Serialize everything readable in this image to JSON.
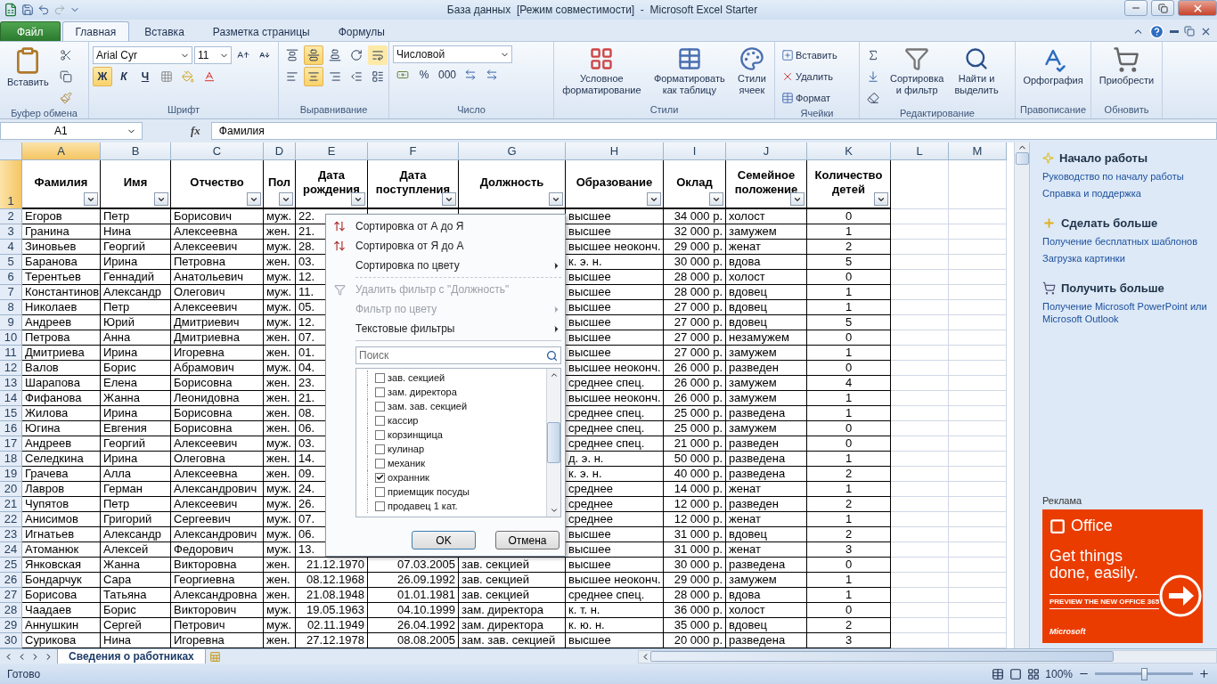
{
  "window": {
    "title": "База данных  [Режим совместимости]  -  Microsoft Excel Starter"
  },
  "tabs": [
    {
      "label": "Файл",
      "kind": "file",
      "selected": false
    },
    {
      "label": "Главная",
      "kind": "tab",
      "selected": true
    },
    {
      "label": "Вставка",
      "kind": "tab",
      "selected": false
    },
    {
      "label": "Разметка страницы",
      "kind": "tab",
      "selected": false
    },
    {
      "label": "Формулы",
      "kind": "tab",
      "selected": false
    }
  ],
  "ribbon": {
    "clipboard": {
      "label": "Буфер обмена",
      "paste": "Вставить"
    },
    "font": {
      "label": "Шрифт",
      "font_name": "Arial Cyr",
      "font_size": "11",
      "bold": {
        "label": "Ж",
        "on": true
      },
      "italic": "К",
      "underline": "Ч"
    },
    "alignment": {
      "label": "Выравнивание",
      "middle_on": true,
      "center_on": true
    },
    "number": {
      "label": "Число",
      "format": "Числовой",
      "percent": "%",
      "thousands": "000"
    },
    "styles": {
      "label": "Стили",
      "buttons": [
        "Условное\nформатирование",
        "Форматировать\nкак таблицу",
        "Стили\nячеек"
      ]
    },
    "cells": {
      "label": "Ячейки",
      "buttons": [
        "Вставить",
        "Удалить",
        "Формат"
      ]
    },
    "editing": {
      "label": "Редактирование",
      "buttons": [
        "Сортировка\nи фильтр",
        "Найти и\nвыделить"
      ]
    },
    "spelling": {
      "label": "Правописание",
      "button": "Орфография"
    },
    "update": {
      "label": "Обновить",
      "button": "Приобрести"
    }
  },
  "formula_bar": {
    "name_box": "A1",
    "fx": "fx",
    "value": "Фамилия"
  },
  "table": {
    "column_letters": [
      {
        "label": "A",
        "selected": true
      },
      {
        "label": "B",
        "selected": false
      },
      {
        "label": "C",
        "selected": false
      },
      {
        "label": "D",
        "selected": false
      },
      {
        "label": "E",
        "selected": false
      },
      {
        "label": "F",
        "selected": false
      },
      {
        "label": "G",
        "selected": false
      },
      {
        "label": "H",
        "selected": false
      },
      {
        "label": "I",
        "selected": false
      },
      {
        "label": "J",
        "selected": false
      },
      {
        "label": "K",
        "selected": false
      },
      {
        "label": "L",
        "selected": false
      },
      {
        "label": "M",
        "selected": false
      }
    ],
    "header_row": {
      "number": "1",
      "selected": true
    },
    "columns": [
      "Фамилия",
      "Имя",
      "Отчество",
      "Пол",
      "Дата\nрождения",
      "Дата\nпоступления",
      "Должность",
      "Образование",
      "Оклад",
      "Семейное\nположение",
      "Количество\nдетей"
    ],
    "rows": [
      {
        "n": "2",
        "cells": [
          "Егоров",
          "Петр",
          "Борисович",
          "муж.",
          "22.",
          null,
          null,
          "высшее",
          "34 000 р.",
          "холост",
          "0"
        ]
      },
      {
        "n": "3",
        "cells": [
          "Гранина",
          "Нина",
          "Алексеевна",
          "жен.",
          "21.",
          null,
          null,
          "высшее",
          "32 000 р.",
          "замужем",
          "1"
        ]
      },
      {
        "n": "4",
        "cells": [
          "Зиновьев",
          "Георгий",
          "Алексеевич",
          "муж.",
          "28.",
          null,
          null,
          "высшее неоконч.",
          "29 000 р.",
          "женат",
          "2"
        ]
      },
      {
        "n": "5",
        "cells": [
          "Баранова",
          "Ирина",
          "Петровна",
          "жен.",
          "03.",
          null,
          null,
          "к. э. н.",
          "30 000 р.",
          "вдова",
          "5"
        ]
      },
      {
        "n": "6",
        "cells": [
          "Терентьев",
          "Геннадий",
          "Анатольевич",
          "муж.",
          "12.",
          null,
          null,
          "высшее",
          "28 000 р.",
          "холост",
          "0"
        ]
      },
      {
        "n": "7",
        "cells": [
          "Константинов",
          "Александр",
          "Олегович",
          "муж.",
          "11.",
          null,
          null,
          "высшее",
          "28 000 р.",
          "вдовец",
          "1"
        ]
      },
      {
        "n": "8",
        "cells": [
          "Николаев",
          "Петр",
          "Алексеевич",
          "муж.",
          "05.",
          null,
          null,
          "высшее",
          "27 000 р.",
          "вдовец",
          "1"
        ]
      },
      {
        "n": "9",
        "cells": [
          "Андреев",
          "Юрий",
          "Дмитриевич",
          "муж.",
          "12.",
          null,
          null,
          "высшее",
          "27 000 р.",
          "вдовец",
          "5"
        ]
      },
      {
        "n": "10",
        "cells": [
          "Петрова",
          "Анна",
          "Дмитриевна",
          "жен.",
          "07.",
          null,
          null,
          "высшее",
          "27 000 р.",
          "незамужем",
          "0"
        ]
      },
      {
        "n": "11",
        "cells": [
          "Дмитриева",
          "Ирина",
          "Игоревна",
          "жен.",
          "01.",
          null,
          null,
          "высшее",
          "27 000 р.",
          "замужем",
          "1"
        ]
      },
      {
        "n": "12",
        "cells": [
          "Валов",
          "Борис",
          "Абрамович",
          "муж.",
          "04.",
          null,
          null,
          "высшее неоконч.",
          "26 000 р.",
          "разведен",
          "0"
        ]
      },
      {
        "n": "13",
        "cells": [
          "Шарапова",
          "Елена",
          "Борисовна",
          "жен.",
          "23.",
          null,
          null,
          "среднее спец.",
          "26 000 р.",
          "замужем",
          "4"
        ]
      },
      {
        "n": "14",
        "cells": [
          "Фифанова",
          "Жанна",
          "Леонидовна",
          "жен.",
          "21.",
          null,
          null,
          "высшее неоконч.",
          "26 000 р.",
          "замужем",
          "1"
        ]
      },
      {
        "n": "15",
        "cells": [
          "Жилова",
          "Ирина",
          "Борисовна",
          "жен.",
          "08.",
          null,
          null,
          "среднее спец.",
          "25 000 р.",
          "разведена",
          "1"
        ]
      },
      {
        "n": "16",
        "cells": [
          "Югина",
          "Евгения",
          "Борисовна",
          "жен.",
          "06.",
          null,
          null,
          "среднее спец.",
          "25 000 р.",
          "замужем",
          "0"
        ]
      },
      {
        "n": "17",
        "cells": [
          "Андреев",
          "Георгий",
          "Алексеевич",
          "муж.",
          "03.",
          null,
          null,
          "среднее спец.",
          "21 000 р.",
          "разведен",
          "0"
        ]
      },
      {
        "n": "18",
        "cells": [
          "Селедкина",
          "Ирина",
          "Олеговна",
          "жен.",
          "14.",
          null,
          null,
          "д. э. н.",
          "50 000 р.",
          "разведена",
          "1"
        ]
      },
      {
        "n": "19",
        "cells": [
          "Грачева",
          "Алла",
          "Алексеевна",
          "жен.",
          "09.",
          null,
          null,
          "к. э. н.",
          "40 000 р.",
          "разведена",
          "2"
        ]
      },
      {
        "n": "20",
        "cells": [
          "Лавров",
          "Герман",
          "Александрович",
          "муж.",
          "24.",
          null,
          null,
          "среднее",
          "14 000 р.",
          "женат",
          "1"
        ]
      },
      {
        "n": "21",
        "cells": [
          "Чупятов",
          "Петр",
          "Алексеевич",
          "муж.",
          "26.",
          null,
          null,
          "среднее",
          "12 000 р.",
          "разведен",
          "2"
        ]
      },
      {
        "n": "22",
        "cells": [
          "Анисимов",
          "Григорий",
          "Сергеевич",
          "муж.",
          "07.",
          null,
          null,
          "среднее",
          "12 000 р.",
          "женат",
          "1"
        ]
      },
      {
        "n": "23",
        "cells": [
          "Игнатьев",
          "Александр",
          "Александрович",
          "муж.",
          "06.",
          null,
          null,
          "высшее",
          "31 000 р.",
          "вдовец",
          "2"
        ]
      },
      {
        "n": "24",
        "cells": [
          "Атоманюк",
          "Алексей",
          "Федорович",
          "муж.",
          "13.",
          null,
          null,
          "высшее",
          "31 000 р.",
          "женат",
          "3"
        ]
      },
      {
        "n": "25",
        "cells": [
          "Янковская",
          "Жанна",
          "Викторовна",
          "жен.",
          "21.12.1970",
          "07.03.2005",
          "зав. секцией",
          "высшее",
          "30 000 р.",
          "разведена",
          "0"
        ]
      },
      {
        "n": "26",
        "cells": [
          "Бондарчук",
          "Сара",
          "Георгиевна",
          "жен.",
          "08.12.1968",
          "26.09.1992",
          "зав. секцией",
          "высшее неоконч.",
          "29 000 р.",
          "замужем",
          "1"
        ]
      },
      {
        "n": "27",
        "cells": [
          "Борисова",
          "Татьяна",
          "Александровна",
          "жен.",
          "21.08.1948",
          "01.01.1981",
          "зав. секцией",
          "среднее спец.",
          "28 000 р.",
          "вдова",
          "1"
        ]
      },
      {
        "n": "28",
        "cells": [
          "Чаадаев",
          "Борис",
          "Викторович",
          "муж.",
          "19.05.1963",
          "04.10.1999",
          "зам. директора",
          "к. т. н.",
          "36 000 р.",
          "холост",
          "0"
        ]
      },
      {
        "n": "29",
        "cells": [
          "Аннушкин",
          "Сергей",
          "Петрович",
          "муж.",
          "02.11.1949",
          "26.04.1992",
          "зам. директора",
          "к. ю. н.",
          "35 000 р.",
          "вдовец",
          "2"
        ]
      },
      {
        "n": "30",
        "cells": [
          "Сурикова",
          "Нина",
          "Игоревна",
          "жен.",
          "27.12.1978",
          "08.08.2005",
          "зам. зав. секцией",
          "высшее",
          "20 000 р.",
          "разведена",
          "3"
        ]
      }
    ]
  },
  "filter_menu": {
    "groups": [
      [
        {
          "label": "Сортировка от А до Я",
          "kind": "sort_az",
          "disabled": false,
          "submenu": false
        },
        {
          "label": "Сортировка от Я до А",
          "kind": "sort_za",
          "disabled": false,
          "submenu": false
        },
        {
          "label": "Сортировка по цвету",
          "kind": "plain",
          "disabled": false,
          "submenu": true
        }
      ],
      [
        {
          "label": "Удалить фильтр с \"Должность\"",
          "kind": "clear_filter",
          "disabled": true,
          "submenu": false
        },
        {
          "label": "Фильтр по цвету",
          "kind": "plain",
          "disabled": true,
          "submenu": true
        },
        {
          "label": "Текстовые фильтры",
          "kind": "plain",
          "disabled": false,
          "submenu": true
        }
      ]
    ],
    "search": {
      "placeholder": "Поиск"
    },
    "values": [
      {
        "label": "зав. секцией",
        "checked": false
      },
      {
        "label": "зам. директора",
        "checked": false
      },
      {
        "label": "зам. зав. секцией",
        "checked": false
      },
      {
        "label": "кассир",
        "checked": false
      },
      {
        "label": "корзинщица",
        "checked": false
      },
      {
        "label": "кулинар",
        "checked": false
      },
      {
        "label": "механик",
        "checked": false
      },
      {
        "label": "охранник",
        "checked": true
      },
      {
        "label": "приемщик посуды",
        "checked": false
      },
      {
        "label": "продавец 1 кат.",
        "checked": false
      }
    ],
    "buttons": [
      "OK",
      "Отмена"
    ]
  },
  "side_pane": {
    "sections": [
      {
        "title": "Начало работы",
        "kind": "start",
        "links": [
          "Руководство по началу работы",
          "Справка и поддержка"
        ]
      },
      {
        "title": "Сделать больше",
        "kind": "more",
        "links": [
          "Получение бесплатных шаблонов",
          "Загрузка картинки"
        ]
      },
      {
        "title": "Получить больше",
        "kind": "buy",
        "links": [
          "Получение Microsoft PowerPoint или Microsoft Outlook"
        ]
      }
    ],
    "ad_label": "Реклама",
    "ad": {
      "brand": "Office",
      "headline": "Get things done, easily.",
      "cta": "PREVIEW THE NEW OFFICE 365",
      "maker": "Microsoft"
    }
  },
  "sheet_tabs": [
    {
      "label": "Сведения о работниках",
      "selected": true
    }
  ],
  "status_bar": {
    "ready": "Готово",
    "zoom": "100%",
    "zoom_slider": {
      "level": 0.5
    }
  }
}
